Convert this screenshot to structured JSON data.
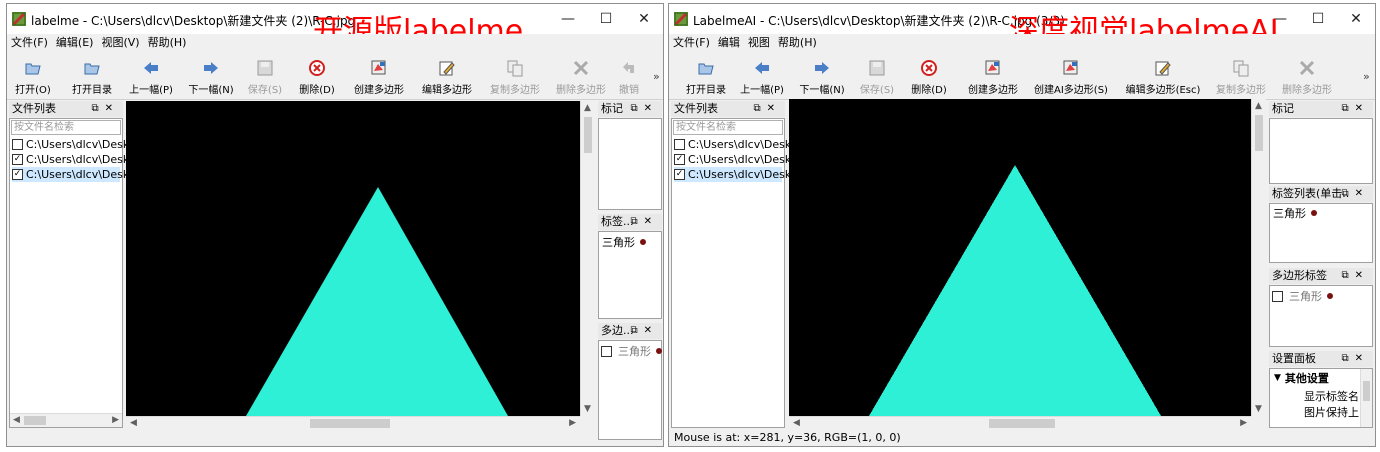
{
  "left_window": {
    "title": "labelme - C:\\Users\\dlcv\\Desktop\\新建文件夹 (2)\\R-C.jpg",
    "overlay_label": "开源版labelme",
    "window_controls": [
      "—",
      "☐",
      "✕"
    ],
    "menu": [
      "文件(F)",
      "编辑(E)",
      "视图(V)",
      "帮助(H)"
    ],
    "toolbar": {
      "open": "打开(O)",
      "open_dir": "打开目录",
      "prev": "上一幅(P)",
      "next": "下一幅(N)",
      "save": "保存(S)",
      "delete": "删除(D)",
      "create_polygon": "创建多边形",
      "edit_polygon": "编辑多边形",
      "copy_polygon": "复制多边形",
      "delete_polygon": "删除多边形",
      "undo": "撤销",
      "more": "»"
    },
    "file_list": {
      "title": "文件列表",
      "search_placeholder": "按文件名检索",
      "items": [
        {
          "path": "C:\\Users\\dlcv\\Deskt",
          "checked": false
        },
        {
          "path": "C:\\Users\\dlcv\\Deskt",
          "checked": true
        },
        {
          "path": "C:\\Users\\dlcv\\Deskt",
          "checked": true
        }
      ]
    },
    "flags_panel": {
      "title": "标记"
    },
    "labels_panel": {
      "title": "标签...",
      "items": [
        "三角形"
      ]
    },
    "polygon_panel": {
      "title": "多边...",
      "items": [
        "三角形"
      ]
    }
  },
  "right_window": {
    "title": "LabelmeAI - C:\\Users\\dlcv\\Desktop\\新建文件夹 (2)\\R-C.jpg (3/3)",
    "overlay_label": "深度视觉labelmeAI",
    "window_controls": [
      "—",
      "☐",
      "✕"
    ],
    "menu": [
      "文件(F)",
      "编辑",
      "视图",
      "帮助(H)"
    ],
    "toolbar": {
      "open_dir": "打开目录",
      "prev": "上一幅(P)",
      "next": "下一幅(N)",
      "save": "保存(S)",
      "delete": "删除(D)",
      "create_polygon": "创建多边形",
      "create_ai_polygon": "创建AI多边形(S)",
      "edit_polygon": "编辑多边形(Esc)",
      "copy_polygon": "复制多边形",
      "delete_polygon": "删除多边形",
      "more": "»"
    },
    "file_list": {
      "title": "文件列表",
      "search_placeholder": "按文件名检索",
      "items": [
        {
          "path": "C:\\Users\\dlcv\\Deskt",
          "checked": false
        },
        {
          "path": "C:\\Users\\dlcv\\Deskt",
          "checked": true
        },
        {
          "path": "C:\\Users\\dlcv\\Deskt",
          "checked": true
        }
      ]
    },
    "flags_panel": {
      "title": "标记"
    },
    "label_list_panel": {
      "title": "标签列表(单击..",
      "items": [
        "三角形"
      ]
    },
    "polygon_labels_panel": {
      "title": "多边形标签",
      "items": [
        "三角形"
      ]
    },
    "settings_panel": {
      "title": "设置面板",
      "section": "其他设置",
      "items": [
        "显示标签名",
        "图片保持上"
      ]
    },
    "status": "Mouse is at: x=281, y=36, RGB=(1, 0, 0)"
  },
  "colors": {
    "triangle": "#2df0d6",
    "canvas_bg": "#000000",
    "overlay_text": "#ff0000",
    "label_dot": "#7b1010",
    "selection": "#cde8ff"
  }
}
